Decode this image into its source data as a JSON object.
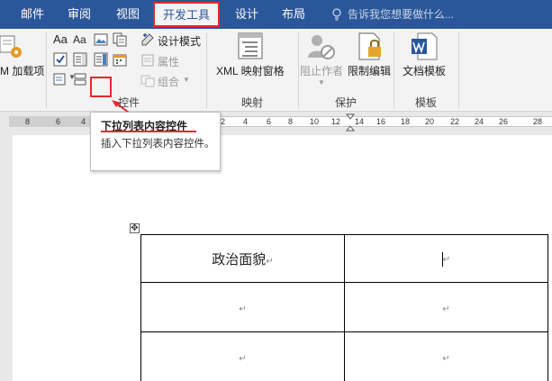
{
  "tabs": [
    {
      "label": "邮件",
      "active": false
    },
    {
      "label": "审阅",
      "active": false
    },
    {
      "label": "视图",
      "active": false
    },
    {
      "label": "开发工具",
      "active": true
    },
    {
      "label": "设计",
      "active": false
    },
    {
      "label": "布局",
      "active": false
    }
  ],
  "tell_me": {
    "text": "告诉我您想要做什么..."
  },
  "ribbon": {
    "addins": {
      "label": "加载项",
      "partial_prefix": "M"
    },
    "controls": {
      "design_mode": "设计模式",
      "properties": "属性",
      "group": "组合",
      "group_label": "控件"
    },
    "mapping": {
      "xml_pane": "XML 映射窗格",
      "group_label": "映射"
    },
    "protect": {
      "block_authors": "阻止作者",
      "restrict_editing": "限制编辑",
      "group_label": "保护"
    },
    "templates": {
      "doc_template": "文档模板",
      "group_label": "模板"
    }
  },
  "ruler": {
    "numbers": [
      "8",
      "6",
      "4",
      "2",
      "2",
      "4",
      "6",
      "8",
      "10",
      "12",
      "14",
      "16",
      "18",
      "20",
      "22",
      "24",
      "26",
      "28"
    ]
  },
  "tooltip": {
    "title": "下拉列表内容控件",
    "description": "插入下拉列表内容控件。"
  },
  "document": {
    "table": [
      [
        "政治面貌",
        ""
      ],
      [
        "",
        ""
      ],
      [
        "",
        ""
      ]
    ],
    "paragraph_mark": "↵",
    "move_handle": "✥"
  },
  "colors": {
    "accent": "#2b579a",
    "highlight": "#e8262e"
  }
}
